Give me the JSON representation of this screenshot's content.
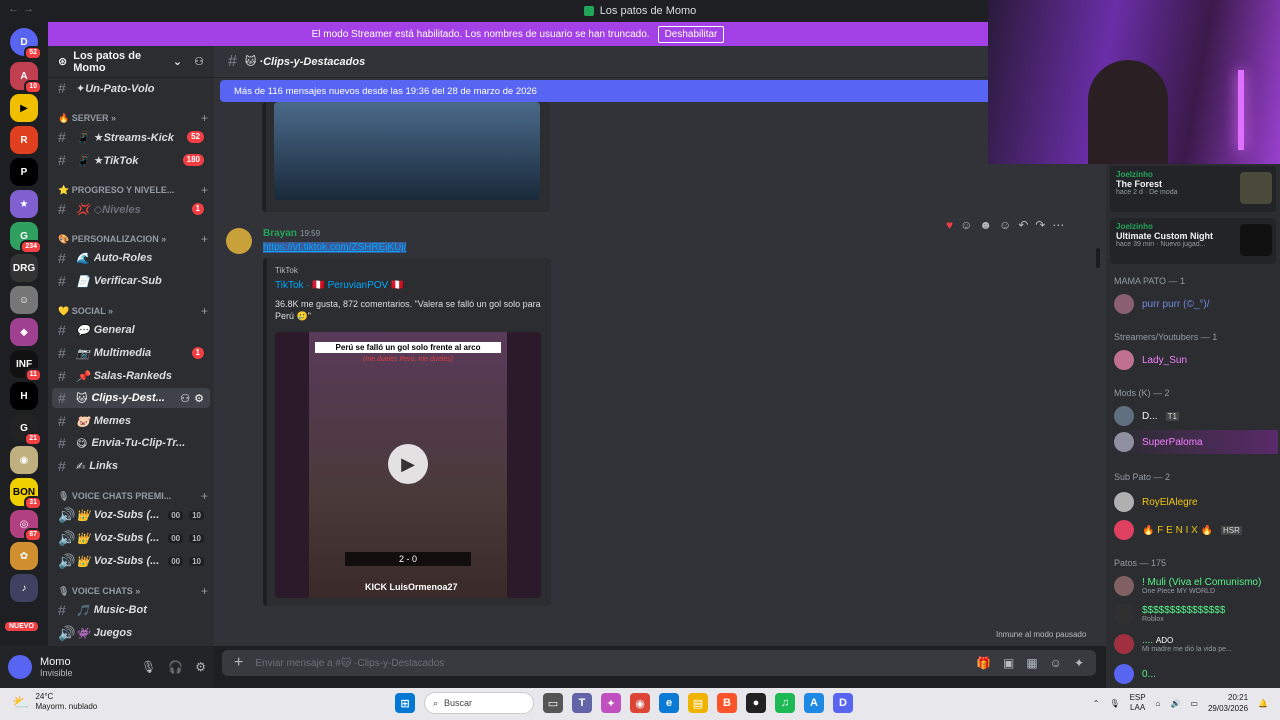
{
  "titlebar": {
    "title": "Los patos de Momo"
  },
  "banner": {
    "text": "El modo Streamer está habilitado. Los nombres de usuario se han truncado.",
    "button": "Deshabilitar"
  },
  "server": {
    "name": "Los patos de Momo"
  },
  "guild_badges": [
    "52",
    "10",
    "234",
    "11",
    "21",
    "31",
    "87"
  ],
  "guild_nuevo": "NUEVO",
  "sidebar": {
    "rows": [
      {
        "label": "✦Un-Pato-Volo",
        "icon": "",
        "count": ""
      },
      {
        "label": "★Streams-Kick",
        "icon": "📱",
        "count": "52"
      },
      {
        "label": "★TikTok",
        "icon": "📱",
        "count": "180"
      },
      {
        "label": "◇Niveles",
        "icon": "💢",
        "count": "1"
      },
      {
        "label": "Auto-Roles",
        "icon": "🌊",
        "count": ""
      },
      {
        "label": "Verificar-Sub",
        "icon": "📄",
        "count": ""
      },
      {
        "label": "General",
        "icon": "💬",
        "count": ""
      },
      {
        "label": "Multimedia",
        "icon": "📷",
        "count": "1"
      },
      {
        "label": "Salas-Rankeds",
        "icon": "📌",
        "count": ""
      },
      {
        "label": "Clips-y-Dest...",
        "icon": "🐱",
        "count": ""
      },
      {
        "label": "Memes",
        "icon": "🐷",
        "count": ""
      },
      {
        "label": "Envia-Tu-Clip-Tr...",
        "icon": "😋",
        "count": ""
      },
      {
        "label": "Links",
        "icon": "✍",
        "count": ""
      },
      {
        "label": "Voz-Subs (...",
        "icon": "👑",
        "count": "",
        "v1": "00",
        "v2": "10"
      },
      {
        "label": "Voz-Subs (...",
        "icon": "👑",
        "count": "",
        "v1": "00",
        "v2": "10"
      },
      {
        "label": "Voz-Subs (...",
        "icon": "👑",
        "count": "",
        "v1": "00",
        "v2": "10"
      },
      {
        "label": "Music-Bot",
        "icon": "🎵",
        "count": ""
      },
      {
        "label": "Juegos",
        "icon": "👾",
        "count": ""
      }
    ],
    "categories": [
      "🔥 SERVER »",
      "⭐ PROGRESO Y NIVELE...",
      "🎨 PERSONALIZACION »",
      "💛 SOCIAL »",
      "🎙 VOICE CHATS PREMI...",
      "🎙 VOICE CHATS »"
    ]
  },
  "user": {
    "name": "Momo",
    "status": "Invisible"
  },
  "chat": {
    "channel": "🐱 ·Clips-y-Destacados",
    "new_messages": "Más de 116 mensajes nuevos desde las 19:36 del 28 de marzo de 2026",
    "author": "Brayan",
    "time": "19:59",
    "link": "https://vt.tiktok.com/ZSHREjKUj/",
    "embed_site": "TikTok",
    "embed_title": "TikTok · 🇵🇪 PeruvianPOV 🇵🇪",
    "embed_desc": "36.8K me gusta, 872 comentarios. \"Valera se falló un gol solo para Perú 🥲\"",
    "video_caption": "Perú se falló un gol solo frente al arco",
    "video_sub": "(me dueles Perú, me dueles)",
    "video_score": "2 - 0",
    "video_watermark": "KICK LuisOrmenoa27",
    "immune": "Inmune al modo pausado",
    "input_placeholder": "Enviar mensaje a #🐱 ·Clips-y-Destacados"
  },
  "members": {
    "activities": [
      {
        "user": "Joelzinho",
        "game": "The Forest",
        "meta": "hace 2 d",
        "tag": "De moda"
      },
      {
        "user": "Joelzinho",
        "game": "Ultimate Custom Night",
        "meta": "hace 39 min",
        "tag": "Nuevo jugad..."
      }
    ],
    "categories": [
      "MAMA PATO — 1",
      "Streamers/Youtubers — 1",
      "Mods (K) — 2",
      "Sub Pato — 2",
      "Patos — 175"
    ],
    "list": [
      {
        "name": "purr purr (©_°)/",
        "color": "#7289da",
        "sub": ""
      },
      {
        "name": "Lady_Sun",
        "color": "#f47fff",
        "sub": ""
      },
      {
        "name": "D...",
        "color": "#f2f3f5",
        "sub": "",
        "tag": "T1"
      },
      {
        "name": "SuperPaloma",
        "color": "#f47fff",
        "sub": ""
      },
      {
        "name": "RoyElAlegre",
        "color": "#f1c40f",
        "sub": ""
      },
      {
        "name": "🔥 F E N I X 🔥",
        "color": "#f1c40f",
        "sub": "",
        "tag": "HSR"
      },
      {
        "name": "! Muli (Viva el Comunismo)",
        "color": "#57f287",
        "sub": "One Piece MY WORLD"
      },
      {
        "name": "$$$$$$$$$$$$$$$",
        "color": "#57f287",
        "sub": "Roblox"
      },
      {
        "name": "....",
        "color": "#57f287",
        "sub": "Mi madre me dió la vida pe...",
        "tag": "ADO"
      },
      {
        "name": "0...",
        "color": "#57f287",
        "sub": ""
      }
    ]
  },
  "taskbar": {
    "temp": "24°C",
    "weather": "Mayorm. nublado",
    "search": "Buscar",
    "lang": "ESP",
    "lang2": "LAA",
    "time": "20:21",
    "date": "29/03/2026"
  },
  "colors": {
    "accent": "#5865f2",
    "streamer": "#a340e6",
    "link": "#00a8fc"
  }
}
